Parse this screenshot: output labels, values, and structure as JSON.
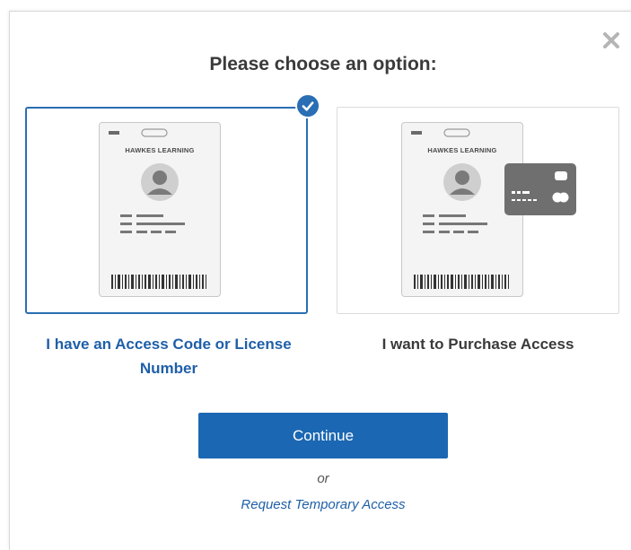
{
  "dialog": {
    "title": "Please choose an option:",
    "close_icon": "close-icon"
  },
  "options": [
    {
      "label": "I have an Access Code or License Number",
      "card_org": "HAWKES LEARNING",
      "selected": true,
      "icon": "id-card-icon"
    },
    {
      "label": "I want to Purchase Access",
      "card_org": "HAWKES LEARNING",
      "selected": false,
      "icon": "id-card-with-credit-card-icon"
    }
  ],
  "actions": {
    "continue_label": "Continue",
    "or_text": "or",
    "temporary_access_link": "Request Temporary Access"
  },
  "colors": {
    "accent": "#1b67b3",
    "selected_border": "#2a6eb4",
    "text_dark": "#3a3a3a"
  }
}
